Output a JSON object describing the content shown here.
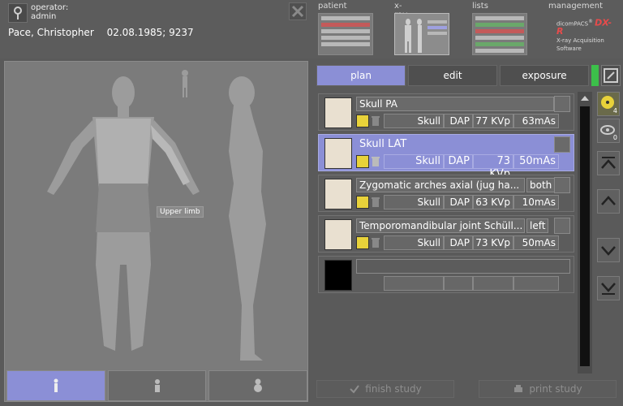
{
  "header": {
    "operator_label": "operator:",
    "operator_name": "admin",
    "patient_name": "Pace, Christopher",
    "patient_details": "02.08.1985; 9237"
  },
  "nav": {
    "patient": "patient",
    "xray": "x-ray",
    "lists": "lists",
    "management": "management"
  },
  "logo": {
    "brand": "dicomPACS",
    "product": "DX-R",
    "subtitle": "X-ray Acquisition Software"
  },
  "body_panel": {
    "tooltip": "Upper limb"
  },
  "tabs": {
    "plan": "plan",
    "edit": "edit",
    "exposure": "exposure"
  },
  "exams": [
    {
      "name": "Skull PA",
      "side": "",
      "region": "Skull",
      "dap": "DAP",
      "kvp": "77 KVp",
      "mas": "63mAs",
      "selected": false
    },
    {
      "name": "Skull LAT",
      "side": "",
      "region": "Skull",
      "dap": "DAP",
      "kvp": "73 KVp",
      "mas": "50mAs",
      "selected": true
    },
    {
      "name": "Zygomatic arches axial (jug ha...",
      "side": "both",
      "region": "Skull",
      "dap": "DAP",
      "kvp": "63 KVp",
      "mas": "10mAs",
      "selected": false
    },
    {
      "name": "Temporomandibular joint Schüll...",
      "side": "left",
      "region": "Skull",
      "dap": "DAP",
      "kvp": "73 KVp",
      "mas": "50mAs",
      "selected": false
    }
  ],
  "right_rail": {
    "radiation_count": "4",
    "viewer_count": "0"
  },
  "footer": {
    "finish": "finish study",
    "print": "print study"
  },
  "colors": {
    "accent": "#8b8fd6",
    "status_green": "#3cc04a",
    "radiation_yellow": "#e8d23a"
  }
}
